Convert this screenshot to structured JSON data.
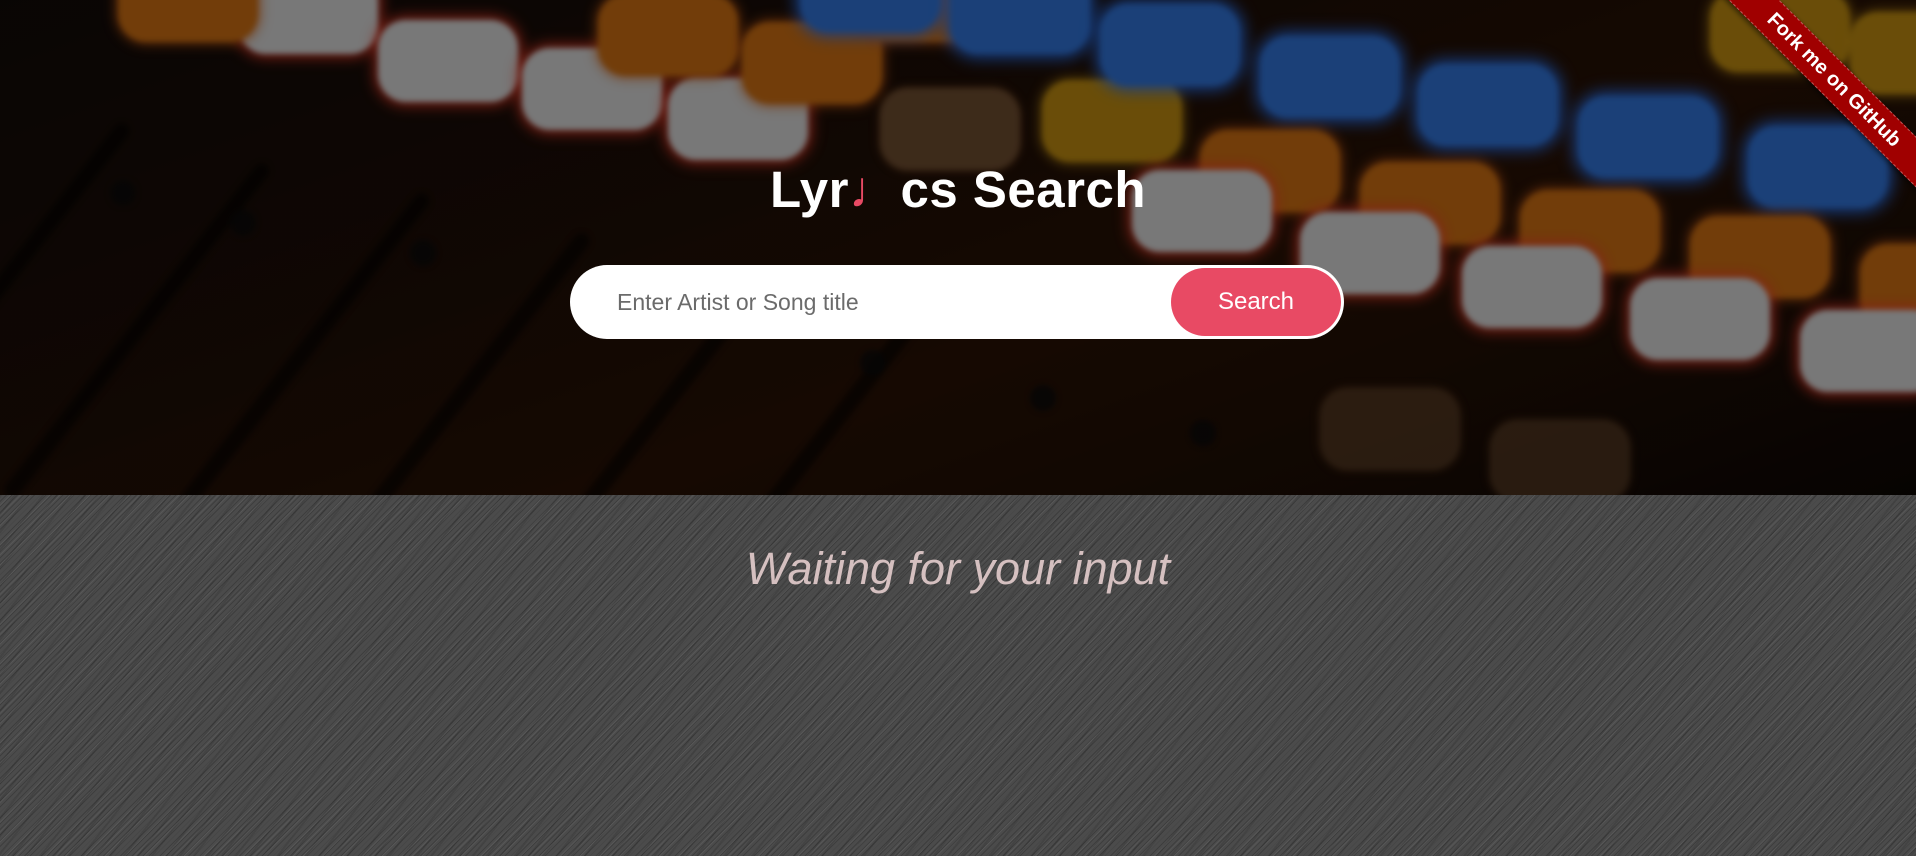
{
  "header": {
    "title_prefix": "Lyr",
    "title_note": "♩",
    "title_suffix": "cs Search"
  },
  "search": {
    "placeholder": "Enter Artist or Song title",
    "value": "",
    "button_label": "Search"
  },
  "ribbon": {
    "label": "Fork me on GitHub"
  },
  "results": {
    "status_text": "Waiting for your input"
  },
  "colors": {
    "accent": "#e84a64",
    "ribbon": "#a00000",
    "status_text": "#d5c0c0"
  }
}
